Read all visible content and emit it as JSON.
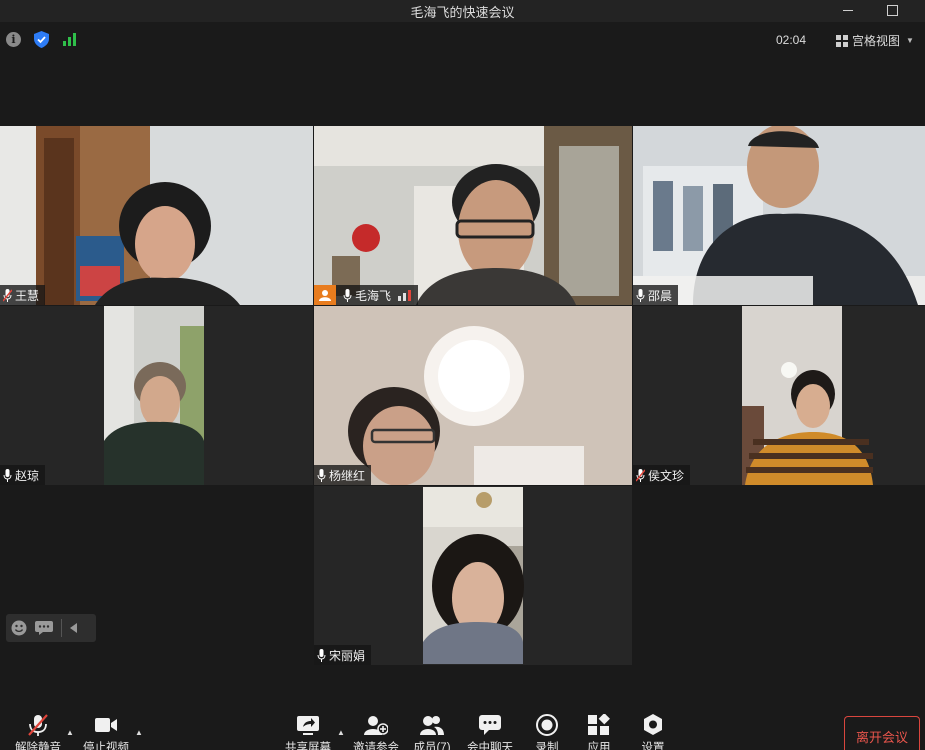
{
  "window": {
    "title": "毛海飞的快速会议"
  },
  "infobar": {
    "timer": "02:04",
    "view_label": "宫格视图"
  },
  "participants": [
    {
      "name": "王慧",
      "muted": true
    },
    {
      "name": "毛海飞",
      "host": true,
      "muted": false
    },
    {
      "name": "邵晨",
      "muted": false
    },
    {
      "name": "赵琼",
      "muted": false
    },
    {
      "name": "杨继红",
      "muted": false
    },
    {
      "name": "侯文珍",
      "muted": true
    },
    {
      "name": "宋丽娟",
      "muted": false,
      "active_speaker": true
    }
  ],
  "toolbar": {
    "unmute_label": "解除静音",
    "stop_video_label": "停止视频",
    "share_label": "共享屏幕",
    "invite_label": "邀请参会",
    "members_label": "成员(7)",
    "chat_label": "会中聊天",
    "record_label": "录制",
    "apps_label": "应用",
    "settings_label": "设置",
    "leave_label": "离开会议"
  },
  "colors": {
    "accent_green": "#29a35a",
    "host_orange": "#e87c1e",
    "leave_red": "#e8554c",
    "mute_red": "#e0453b"
  }
}
